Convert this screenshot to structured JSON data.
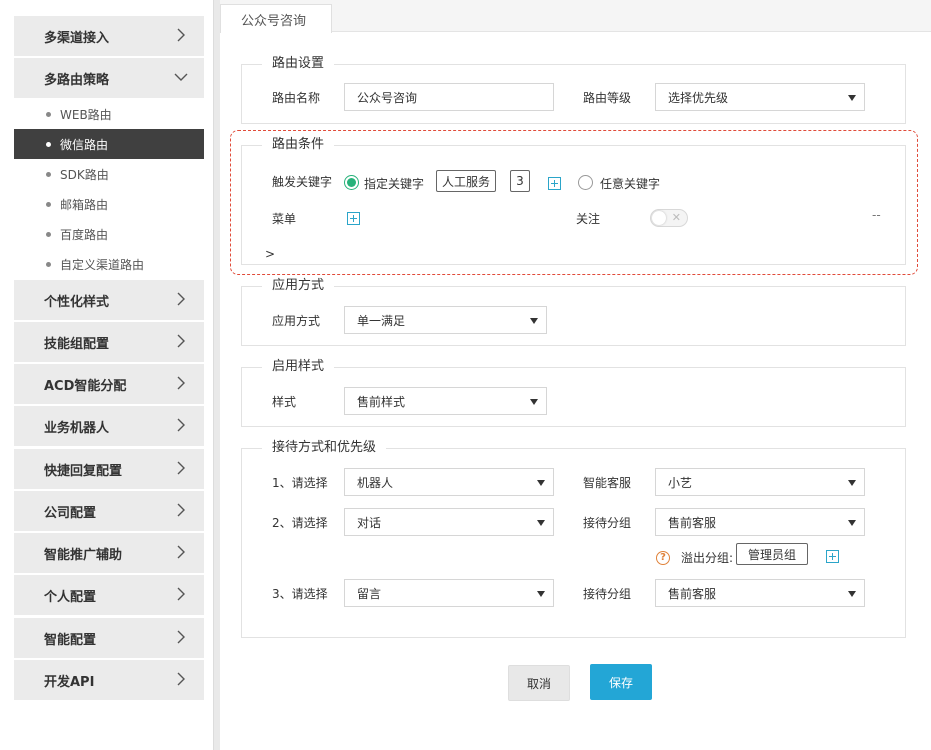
{
  "sidebar": {
    "items": [
      {
        "label": "多渠道接入"
      },
      {
        "label": "多路由策略"
      },
      {
        "label": "个性化样式"
      },
      {
        "label": "技能组配置"
      },
      {
        "label": "ACD智能分配"
      },
      {
        "label": "业务机器人"
      },
      {
        "label": "快捷回复配置"
      },
      {
        "label": "公司配置"
      },
      {
        "label": "智能推广辅助"
      },
      {
        "label": "个人配置"
      },
      {
        "label": "智能配置"
      },
      {
        "label": "开发API"
      }
    ],
    "sub_items": [
      {
        "label": "WEB路由"
      },
      {
        "label": "微信路由"
      },
      {
        "label": "SDK路由"
      },
      {
        "label": "邮箱路由"
      },
      {
        "label": "百度路由"
      },
      {
        "label": "自定义渠道路由"
      }
    ]
  },
  "tab": {
    "label": "公众号咨询"
  },
  "routing_settings": {
    "legend": "路由设置",
    "name_label": "路由名称",
    "name_value": "公众号咨询",
    "level_label": "路由等级",
    "level_value": "选择优先级"
  },
  "routing_conditions": {
    "legend": "路由条件",
    "trigger_label": "触发关键字",
    "specified_keyword": "指定关键字",
    "keyword_tag": "人工服务",
    "keyword_count": "3",
    "any_keyword": "任意关键字",
    "menu_label": "菜单",
    "follow_label": "关注",
    "toggle_off": "✕",
    "dash": "--",
    "expander": ">"
  },
  "apply_method": {
    "legend": "应用方式",
    "label": "应用方式",
    "value": "单一满足"
  },
  "style_section": {
    "legend": "启用样式",
    "label": "样式",
    "value": "售前样式"
  },
  "reception": {
    "legend": "接待方式和优先级",
    "rows": [
      {
        "choose_label": "1、请选择",
        "choose_value": "机器人",
        "right_label": "智能客服",
        "right_value": "小艺"
      },
      {
        "choose_label": "2、请选择",
        "choose_value": "对话",
        "right_label": "接待分组",
        "right_value": "售前客服"
      },
      {
        "choose_label": "3、请选择",
        "choose_value": "留言",
        "right_label": "接待分组",
        "right_value": "售前客服"
      }
    ],
    "overflow_help": "?",
    "overflow_label": "溢出分组:",
    "overflow_tag": "管理员组"
  },
  "buttons": {
    "cancel": "取消",
    "save": "保存"
  },
  "colors": {
    "accent": "#23a6d6",
    "radio_on": "#27b27a",
    "dashed_border": "#e04b3a",
    "active_sub": "#404040"
  }
}
